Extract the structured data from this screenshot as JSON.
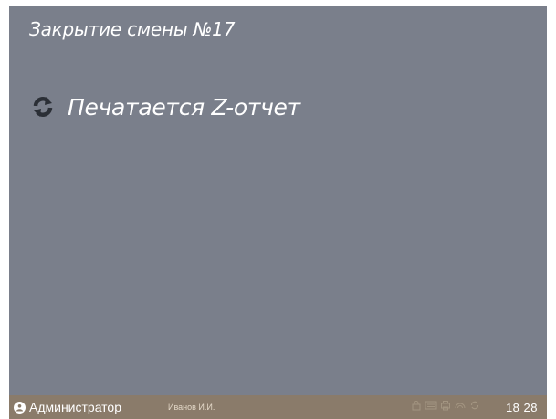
{
  "header": {
    "title": "Закрытие смены №17"
  },
  "status": {
    "icon": "refresh-icon",
    "text": "Печатается Z-отчет"
  },
  "statusbar": {
    "user_icon": "user-icon",
    "role": "Администратор",
    "cashier": "Иванов И.И.",
    "tray_icons": [
      "lock-icon",
      "keyboard-icon",
      "printer-icon",
      "network-icon",
      "sync-icon"
    ],
    "time": "18 28"
  },
  "colors": {
    "screen_bg": "#7a7f8b",
    "statusbar_bg": "#8a7b6a",
    "text": "#ffffff",
    "icon_dark": "#2b2f36"
  }
}
